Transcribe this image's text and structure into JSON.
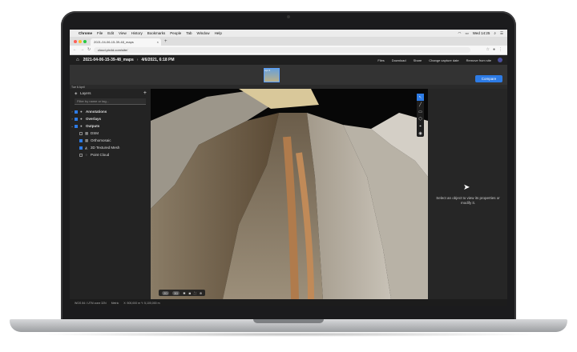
{
  "menubar": {
    "items": [
      "Chrome",
      "File",
      "Edit",
      "View",
      "History",
      "Bookmarks",
      "People",
      "Tab",
      "Window",
      "Help"
    ],
    "clock": "Wed 14:25"
  },
  "browser": {
    "tab_title": "2021-04-06-15-39-48_maps",
    "url": "cloud.pix4d.com/site/"
  },
  "app": {
    "breadcrumb_project": "2021-04-06-15-39-48_maps",
    "breadcrumb_date": "4/6/2021, 6:18 PM",
    "actions": [
      "Files",
      "Download",
      "Share",
      "Change capture date",
      "Remove from site"
    ],
    "compare_label": "Compare",
    "thumb_label": "Apr 6",
    "date_tag": "Tue 6 April"
  },
  "layers": {
    "title": "Layers",
    "search_placeholder": "Filter by name or tag...",
    "groups": [
      {
        "label": "Annotations",
        "checked": true
      },
      {
        "label": "Overlays",
        "checked": true
      },
      {
        "label": "Outputs",
        "checked": true
      }
    ],
    "outputs": [
      {
        "label": "DSM",
        "checked": false
      },
      {
        "label": "Orthomosaic",
        "checked": true
      },
      {
        "label": "3D Textured Mesh",
        "checked": true
      },
      {
        "label": "Point Cloud",
        "checked": false
      }
    ]
  },
  "viewport": {
    "bottom_controls": [
      "2D",
      "3D",
      "settings",
      "camera",
      "fullscreen",
      "zoom"
    ]
  },
  "properties": {
    "message": "Select an object to view its properties or modify it."
  },
  "status": {
    "crs": "WGS 84 / UTM zone 32N",
    "units": "Metric",
    "coords": "X: 500,000 m   Y: 5,100,000 m"
  }
}
